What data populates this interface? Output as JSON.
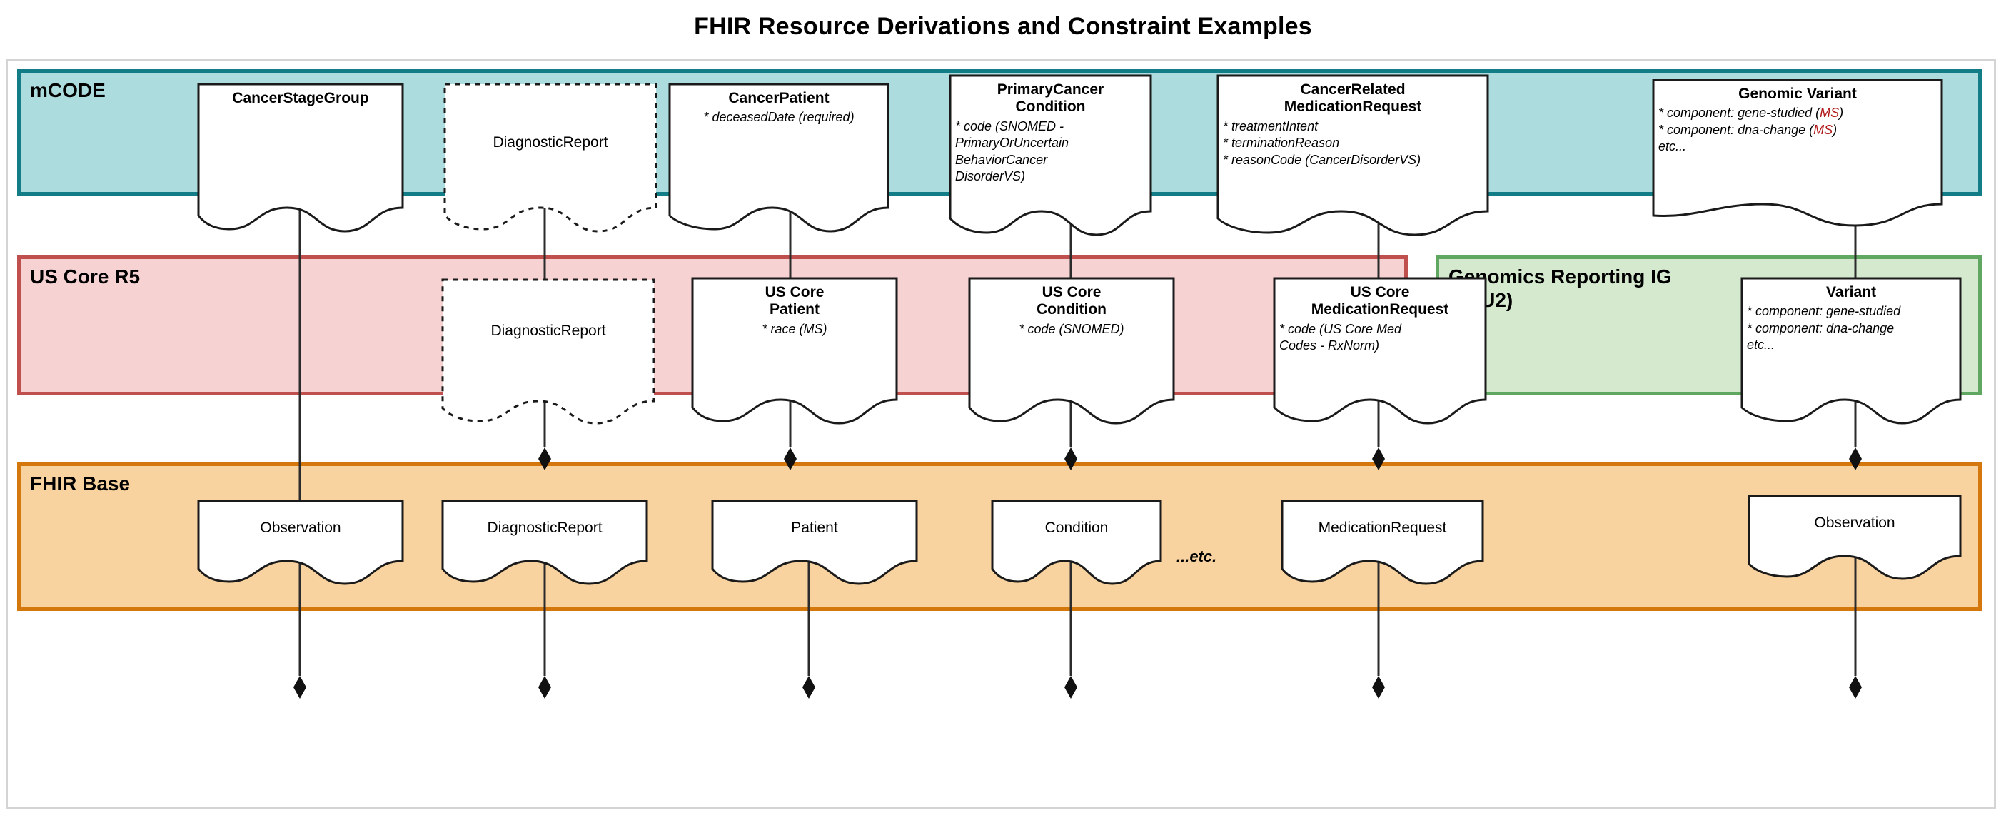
{
  "title": "FHIR Resource Derivations and Constraint Examples",
  "bands": [
    {
      "id": "mcode",
      "label": "mCODE",
      "fill": "#ADDCDE",
      "stroke": "#127C87"
    },
    {
      "id": "uscore",
      "label": "US Core R5",
      "fill": "#F6D2D2",
      "stroke": "#C0504D"
    },
    {
      "id": "genomics",
      "label": "Genomics Reporting IG\n(STU2)",
      "fill": "#D4E9CE",
      "stroke": "#60A862"
    },
    {
      "id": "fhirbase",
      "label": "FHIR Base",
      "fill": "#F8D3A0",
      "stroke": "#D4770C"
    }
  ],
  "nodes": {
    "cancer_stage_group": {
      "title": "CancerStageGroup",
      "attrs": "",
      "style": "solid",
      "band": "mCODE"
    },
    "mcode_diagnostic_report": {
      "title": "DiagnosticReport",
      "attrs": "",
      "style": "dashed",
      "band": "mCODE"
    },
    "cancer_patient": {
      "title": "CancerPatient",
      "attrs": "* deceasedDate (required)",
      "style": "solid",
      "band": "mCODE"
    },
    "primary_cancer_condition": {
      "title": "PrimaryCancer\nCondition",
      "attrs": "* code (SNOMED -\nPrimaryOrUncertain\nBehaviorCancer\nDisorderVS)",
      "style": "solid",
      "band": "mCODE"
    },
    "cancer_related_medication_request": {
      "title": "CancerRelated\nMedicationRequest",
      "attrs": "* treatmentIntent\n* terminationReason\n* reasonCode (CancerDisorderVS)",
      "style": "solid",
      "band": "mCODE"
    },
    "genomic_variant": {
      "title": "Genomic Variant",
      "attrs_html": "* component: gene-studied (<span class=\"ms\">MS</span>)<br>* component: dna-change (<span class=\"ms\">MS</span>)<br>etc...",
      "style": "solid",
      "band": "mCODE"
    },
    "uscore_diagnostic_report": {
      "title": "DiagnosticReport",
      "attrs": "",
      "style": "dashed",
      "band": "US Core R5"
    },
    "us_core_patient": {
      "title": "US Core\nPatient",
      "attrs": "* race (MS)",
      "style": "solid",
      "band": "US Core R5"
    },
    "us_core_condition": {
      "title": "US Core\nCondition",
      "attrs": "* code (SNOMED)",
      "style": "solid",
      "band": "US Core R5"
    },
    "us_core_medication_request": {
      "title": "US Core\nMedicationRequest",
      "attrs": "* code (US Core Med\nCodes - RxNorm)",
      "style": "solid",
      "band": "US Core R5"
    },
    "variant": {
      "title": "Variant",
      "attrs": "* component: gene-studied\n* component: dna-change\netc...",
      "style": "solid",
      "band": "Genomics Reporting IG (STU2)"
    },
    "base_observation_left": {
      "title": "Observation",
      "attrs": "",
      "style": "solid",
      "band": "FHIR Base"
    },
    "base_diagnostic_report": {
      "title": "DiagnosticReport",
      "attrs": "",
      "style": "solid",
      "band": "FHIR Base"
    },
    "base_patient": {
      "title": "Patient",
      "attrs": "",
      "style": "solid",
      "band": "FHIR Base"
    },
    "base_condition": {
      "title": "Condition",
      "attrs": "",
      "style": "solid",
      "band": "FHIR Base"
    },
    "base_medication_request": {
      "title": "MedicationRequest",
      "attrs": "",
      "style": "solid",
      "band": "FHIR Base"
    },
    "base_observation_right": {
      "title": "Observation",
      "attrs": "",
      "style": "solid",
      "band": "FHIR Base"
    }
  },
  "etc_label": "...etc.",
  "derivations": [
    {
      "from": "base_observation_left",
      "to": "cancer_stage_group"
    },
    {
      "from": "base_diagnostic_report",
      "to": "uscore_diagnostic_report"
    },
    {
      "from": "uscore_diagnostic_report",
      "to": "mcode_diagnostic_report"
    },
    {
      "from": "base_patient",
      "to": "us_core_patient"
    },
    {
      "from": "us_core_patient",
      "to": "cancer_patient"
    },
    {
      "from": "base_condition",
      "to": "us_core_condition"
    },
    {
      "from": "us_core_condition",
      "to": "primary_cancer_condition"
    },
    {
      "from": "base_medication_request",
      "to": "us_core_medication_request"
    },
    {
      "from": "us_core_medication_request",
      "to": "cancer_related_medication_request"
    },
    {
      "from": "base_observation_right",
      "to": "variant"
    },
    {
      "from": "variant",
      "to": "genomic_variant"
    }
  ]
}
